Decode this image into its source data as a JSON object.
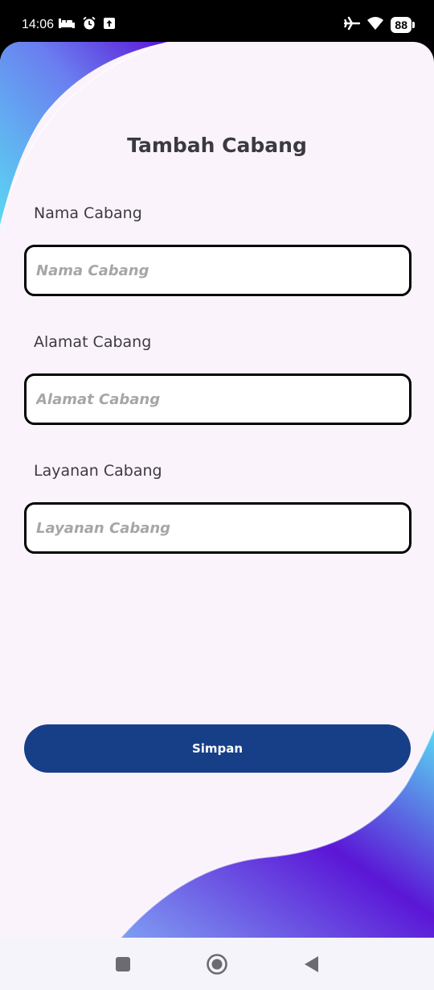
{
  "status_bar": {
    "time": "14:06",
    "battery": "88",
    "left_icons": [
      "bed-icon",
      "alarm-icon",
      "upload-icon"
    ],
    "right_icons": [
      "airplane-icon",
      "wifi-icon",
      "battery-icon"
    ]
  },
  "form": {
    "title": "Tambah Cabang",
    "fields": [
      {
        "label": "Nama Cabang",
        "placeholder": "Nama Cabang",
        "value": ""
      },
      {
        "label": "Alamat Cabang",
        "placeholder": "Alamat Cabang",
        "value": ""
      },
      {
        "label": "Layanan Cabang",
        "placeholder": "Layanan Cabang",
        "value": ""
      }
    ],
    "submit_label": "Simpan"
  },
  "colors": {
    "primary_button": "#163f88",
    "background": "#fbf3fb",
    "wave_start": "#5ad8f2",
    "wave_end": "#5b16d6"
  },
  "nav_bar": {
    "icons": [
      "recents-icon",
      "home-icon",
      "back-icon"
    ]
  }
}
